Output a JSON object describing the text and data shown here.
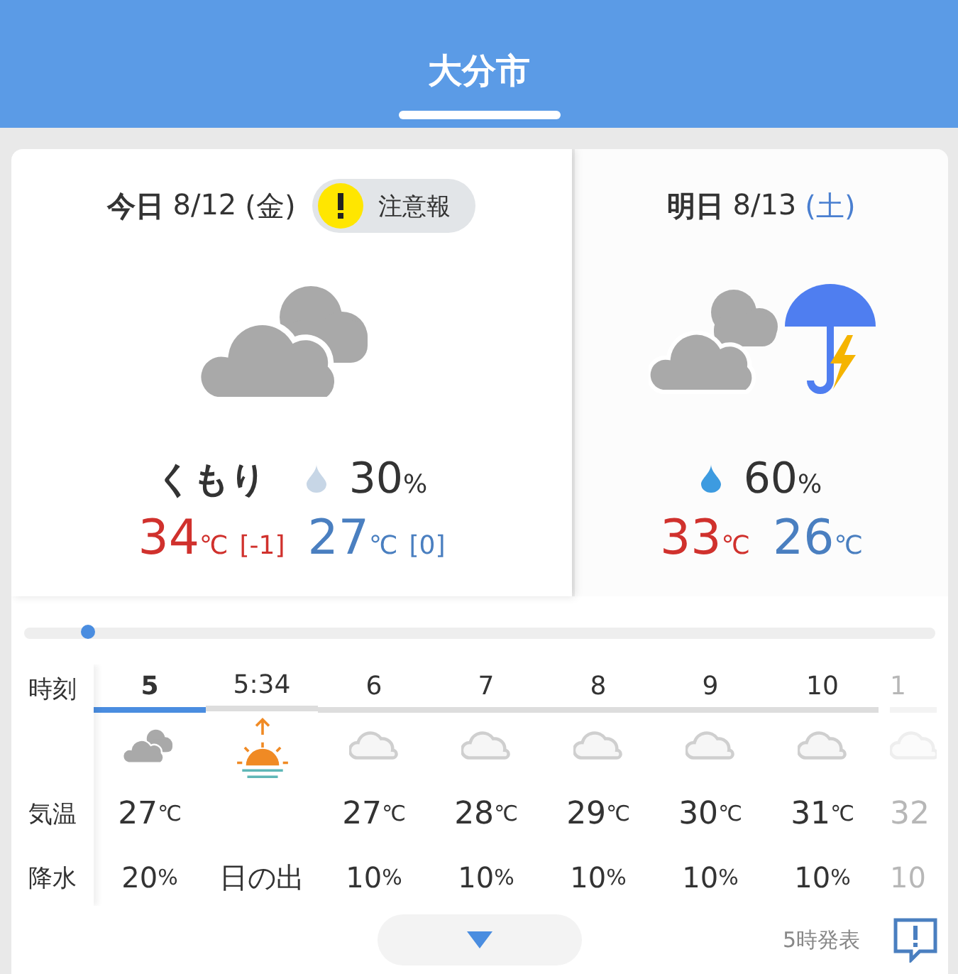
{
  "header": {
    "title": "大分市"
  },
  "days": [
    {
      "label": "今日",
      "date": "8/12",
      "weekday": "(金)",
      "color": "#333333",
      "selected": true,
      "alert": {
        "label": "注意報"
      },
      "kind": "cloudy",
      "condition": "くもり",
      "pop": "30",
      "pop_unit": "%",
      "high": {
        "value": "34",
        "unit": "℃",
        "diff": "[-1]"
      },
      "low": {
        "value": "27",
        "unit": "℃",
        "diff": "[0]"
      }
    },
    {
      "label": "明日",
      "date": "8/13",
      "weekday": "(土)",
      "color": "#4a7fd0",
      "selected": false,
      "kind": "cloudy-thunder",
      "pop": "60",
      "pop_unit": "%",
      "high": {
        "value": "33",
        "unit": "℃"
      },
      "low": {
        "value": "26",
        "unit": "℃"
      }
    }
  ],
  "timeline": {
    "level": 0.07
  },
  "hourly": {
    "row_labels": [
      "時刻",
      "気温",
      "降水"
    ],
    "columns": [
      {
        "time": "5",
        "selected": true,
        "faded": false,
        "kind": "cloudy",
        "temp": "27",
        "temp_unit": "℃",
        "precip": "20",
        "precip_unit": "%"
      },
      {
        "time": "5:34",
        "selected": false,
        "faded": false,
        "kind": "sunrise",
        "precip": "日の出"
      },
      {
        "time": "6",
        "selected": false,
        "faded": false,
        "kind": "cloud-light",
        "temp": "27",
        "temp_unit": "℃",
        "precip": "10",
        "precip_unit": "%"
      },
      {
        "time": "7",
        "selected": false,
        "faded": false,
        "kind": "cloud-light",
        "temp": "28",
        "temp_unit": "℃",
        "precip": "10",
        "precip_unit": "%"
      },
      {
        "time": "8",
        "selected": false,
        "faded": false,
        "kind": "cloud-light",
        "temp": "29",
        "temp_unit": "℃",
        "precip": "10",
        "precip_unit": "%"
      },
      {
        "time": "9",
        "selected": false,
        "faded": false,
        "kind": "cloud-light",
        "temp": "30",
        "temp_unit": "℃",
        "precip": "10",
        "precip_unit": "%"
      },
      {
        "time": "10",
        "selected": false,
        "faded": false,
        "kind": "cloud-light",
        "temp": "31",
        "temp_unit": "℃",
        "precip": "10",
        "precip_unit": "%"
      },
      {
        "time": "1",
        "selected": false,
        "faded": true,
        "kind": "cloud-light",
        "temp": "32",
        "precip": "10"
      }
    ]
  },
  "footer": {
    "issued": "5時発表"
  }
}
